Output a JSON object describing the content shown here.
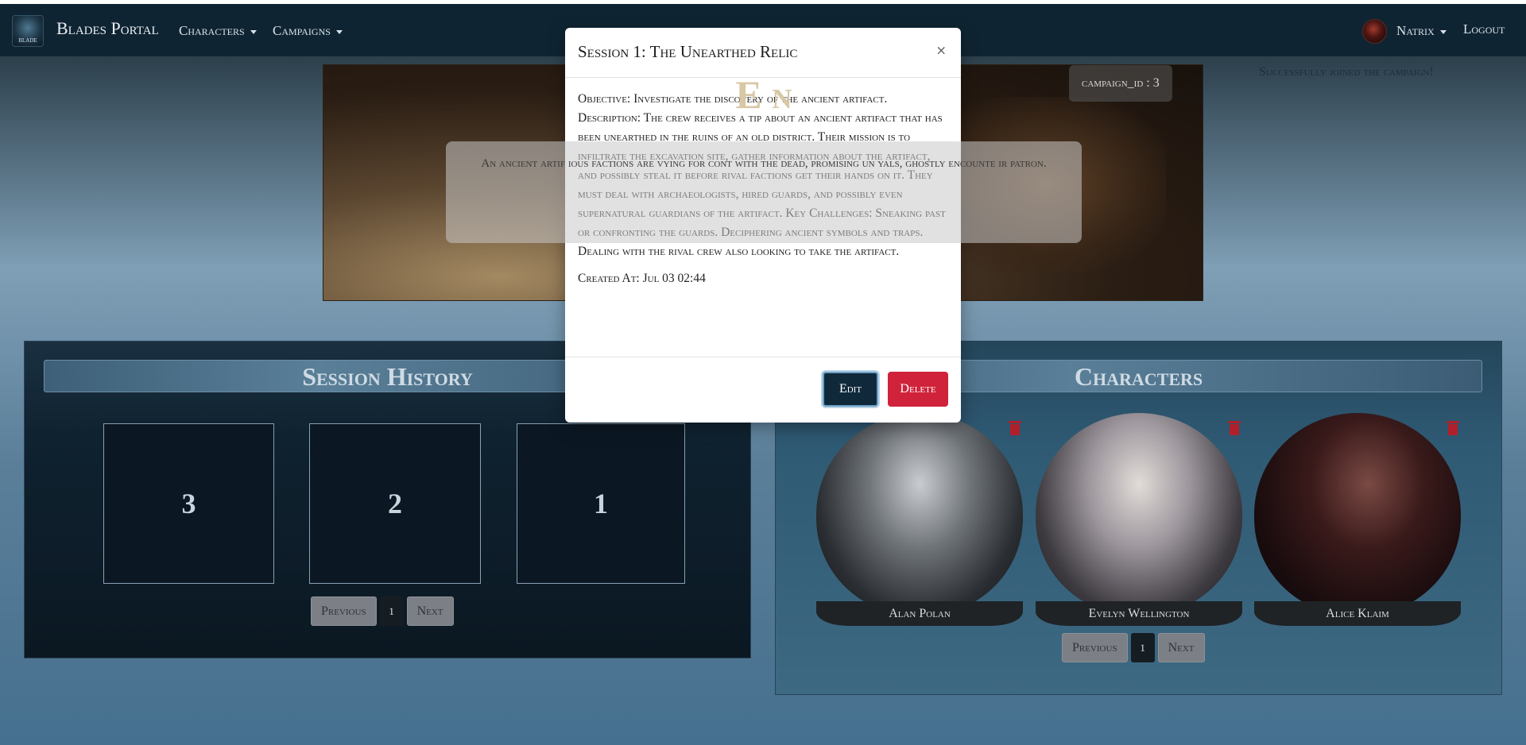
{
  "navbar": {
    "brand": "Blades Portal",
    "characters_label": "Characters",
    "campaigns_label": "Campaigns",
    "user_name": "Natrix",
    "logout_label": "Logout"
  },
  "campaign": {
    "title": "E                                   n",
    "description": "An ancient artif                                                                    ious factions are vying for cont                                                                     with the dead, promising un                                                                 yals, ghostly encounte                                                                ir patron.",
    "id_badge": "campaign_id : 3"
  },
  "toast": {
    "message": "Successfully joined the campaign!",
    "close": "×"
  },
  "session_history": {
    "title": "Session History",
    "sessions": [
      "3",
      "2",
      "1"
    ],
    "pager": {
      "prev": "Previous",
      "page": "1",
      "next": "Next"
    }
  },
  "characters": {
    "title": "Characters",
    "items": [
      {
        "name": "Alan Polan"
      },
      {
        "name": "Evelyn Wellington"
      },
      {
        "name": "Alice Klaim"
      }
    ],
    "pager": {
      "prev": "Previous",
      "page": "1",
      "next": "Next"
    }
  },
  "modal": {
    "title": "Session 1: The Unearthed Relic",
    "close": "×",
    "body": "Objective: Investigate the discovery of the ancient artifact. Description: The crew receives a tip about an ancient artifact that has been unearthed in the ruins of an old district. Their mission is to infiltrate the excavation site, gather information about the artifact, and possibly steal it before rival factions get their hands on it. They must deal with archaeologists, hired guards, and possibly even supernatural guardians of the artifact. Key Challenges: Sneaking past or confronting the guards. Deciphering ancient symbols and traps. Dealing with the rival crew also looking to take the artifact.",
    "created_at": "Created At: Jul 03 02:44",
    "edit_label": "Edit",
    "delete_label": "Delete"
  },
  "colors": {
    "navbar": "#0f2432",
    "delete": "#d0223a",
    "edit": "#10293a"
  }
}
